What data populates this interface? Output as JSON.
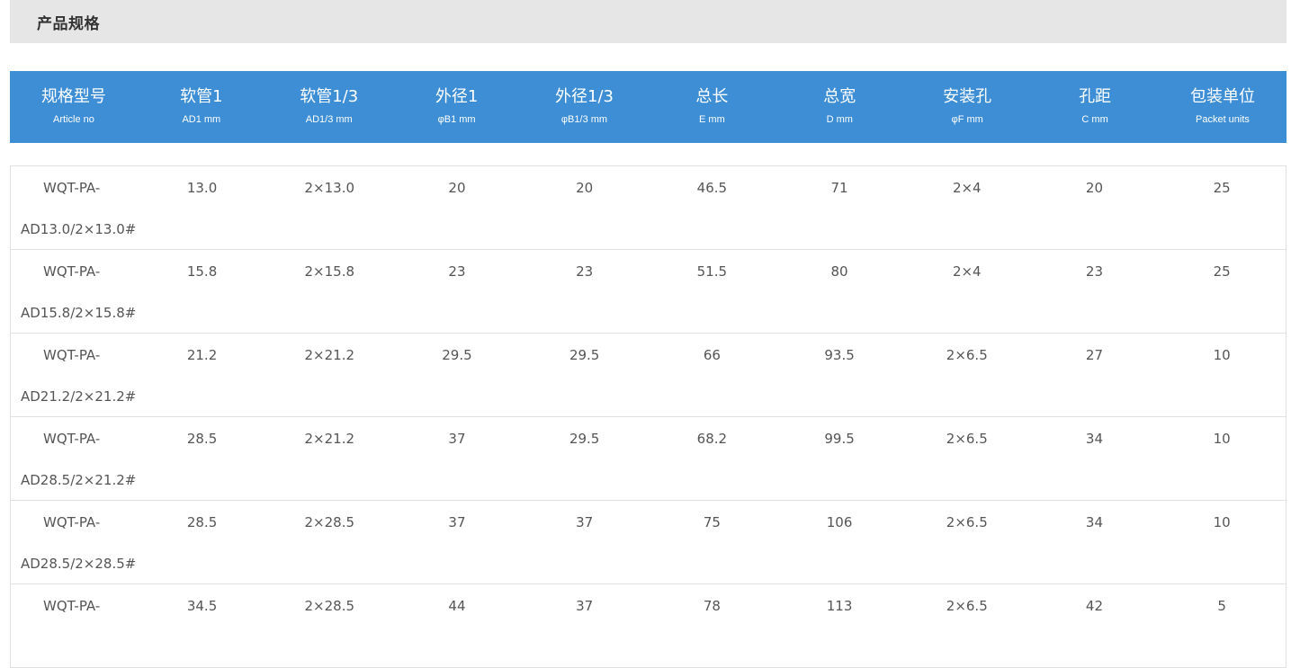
{
  "section": {
    "title": "产品规格"
  },
  "headers": [
    {
      "zh": "规格型号",
      "en": "Article no"
    },
    {
      "zh": "软管1",
      "en": "AD1 mm"
    },
    {
      "zh": "软管1/3",
      "en": "AD1/3 mm"
    },
    {
      "zh": "外径1",
      "en": "φB1 mm"
    },
    {
      "zh": "外径1/3",
      "en": "φB1/3 mm"
    },
    {
      "zh": "总长",
      "en": "E mm"
    },
    {
      "zh": "总宽",
      "en": "D mm"
    },
    {
      "zh": "安装孔",
      "en": "φF mm"
    },
    {
      "zh": "孔距",
      "en": "C mm"
    },
    {
      "zh": "包装单位",
      "en": "Packet units"
    }
  ],
  "rows": [
    {
      "article_line1": "WQT-PA-",
      "article_line2": "AD13.0/2×13.0#",
      "cells": [
        "13.0",
        "2×13.0",
        "20",
        "20",
        "46.5",
        "71",
        "2×4",
        "20",
        "25"
      ]
    },
    {
      "article_line1": "WQT-PA-",
      "article_line2": "AD15.8/2×15.8#",
      "cells": [
        "15.8",
        "2×15.8",
        "23",
        "23",
        "51.5",
        "80",
        "2×4",
        "23",
        "25"
      ]
    },
    {
      "article_line1": "WQT-PA-",
      "article_line2": "AD21.2/2×21.2#",
      "cells": [
        "21.2",
        "2×21.2",
        "29.5",
        "29.5",
        "66",
        "93.5",
        "2×6.5",
        "27",
        "10"
      ]
    },
    {
      "article_line1": "WQT-PA-",
      "article_line2": "AD28.5/2×21.2#",
      "cells": [
        "28.5",
        "2×21.2",
        "37",
        "29.5",
        "68.2",
        "99.5",
        "2×6.5",
        "34",
        "10"
      ]
    },
    {
      "article_line1": "WQT-PA-",
      "article_line2": "AD28.5/2×28.5#",
      "cells": [
        "28.5",
        "2×28.5",
        "37",
        "37",
        "75",
        "106",
        "2×6.5",
        "34",
        "10"
      ]
    },
    {
      "article_line1": "WQT-PA-",
      "article_line2": "",
      "cells": [
        "34.5",
        "2×28.5",
        "44",
        "37",
        "78",
        "113",
        "2×6.5",
        "42",
        "5"
      ]
    }
  ]
}
